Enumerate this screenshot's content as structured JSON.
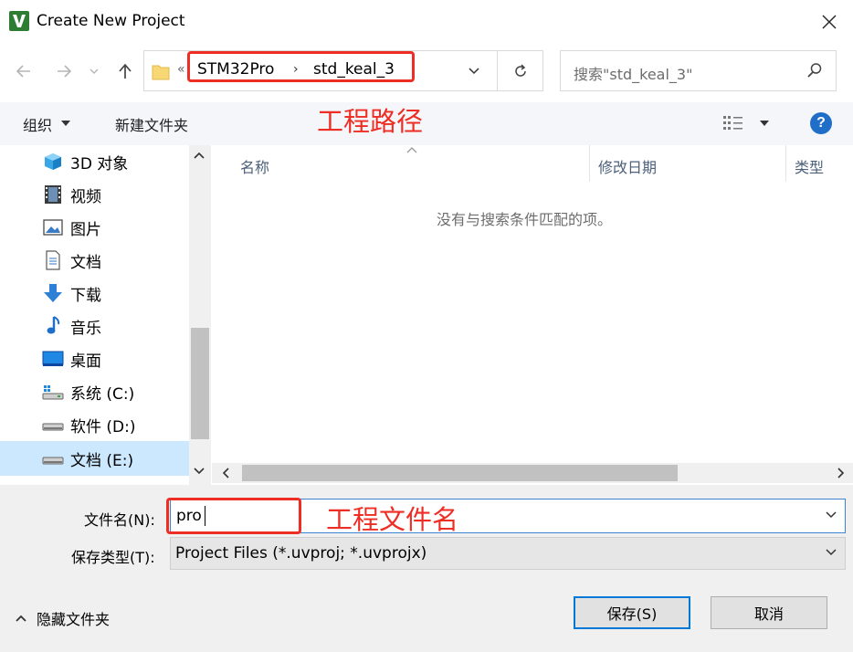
{
  "window": {
    "title": "Create New Project",
    "app_icon": "keil-uvision-icon"
  },
  "nav": {
    "back_icon": "arrow-left-icon",
    "forward_icon": "arrow-right-icon",
    "recent_icon": "chevron-down-icon",
    "up_icon": "arrow-up-icon"
  },
  "address": {
    "overflow_chevron": "«",
    "segments": [
      "STM32Pro",
      "std_keal_3"
    ],
    "separator": "›"
  },
  "search": {
    "placeholder": "搜索\"std_keal_3\""
  },
  "toolbar": {
    "organize_label": "组织",
    "new_folder_label": "新建文件夹",
    "help_label": "?"
  },
  "sidebar": {
    "items": [
      {
        "label": "3D 对象",
        "icon": "3d-objects-icon"
      },
      {
        "label": "视频",
        "icon": "video-icon"
      },
      {
        "label": "图片",
        "icon": "pictures-icon"
      },
      {
        "label": "文档",
        "icon": "documents-icon"
      },
      {
        "label": "下载",
        "icon": "download-icon"
      },
      {
        "label": "音乐",
        "icon": "music-icon"
      },
      {
        "label": "桌面",
        "icon": "desktop-icon"
      },
      {
        "label": "系统 (C:)",
        "icon": "system-drive-icon"
      },
      {
        "label": "软件 (D:)",
        "icon": "drive-icon"
      },
      {
        "label": "文档 (E:)",
        "icon": "drive-icon",
        "selected": true
      }
    ]
  },
  "list": {
    "columns": [
      "名称",
      "修改日期",
      "类型"
    ],
    "empty_message": "没有与搜索条件匹配的项。"
  },
  "annotations": {
    "path_label": "工程路径",
    "filename_label": "工程文件名",
    "color": "#ee2d24"
  },
  "form": {
    "filename_label": "文件名(N):",
    "filename_value": "pro",
    "filetype_label": "保存类型(T):",
    "filetype_value": "Project Files (*.uvproj; *.uvprojx)"
  },
  "footer": {
    "hide_folders_label": "隐藏文件夹",
    "save_label": "保存(S)",
    "cancel_label": "取消"
  },
  "colors": {
    "accent": "#0078d7",
    "toolbar_bg": "#f4f6f9",
    "selection_bg": "#cce8ff"
  }
}
